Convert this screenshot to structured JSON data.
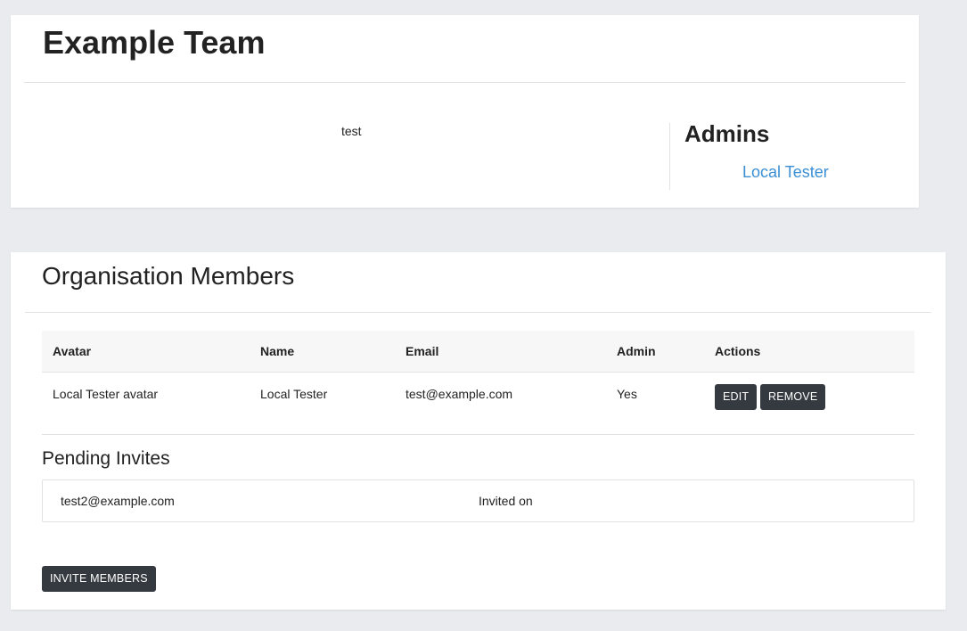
{
  "team": {
    "title": "Example Team",
    "description": "test",
    "admins_heading": "Admins",
    "admins": [
      "Local Tester"
    ]
  },
  "members": {
    "heading": "Organisation Members",
    "columns": [
      "Avatar",
      "Name",
      "Email",
      "Admin",
      "Actions"
    ],
    "rows": [
      {
        "avatar": "Local Tester avatar",
        "name": "Local Tester",
        "email": "test@example.com",
        "admin": "Yes",
        "edit_label": "EDIT",
        "remove_label": "REMOVE"
      }
    ],
    "pending_heading": "Pending Invites",
    "pending": [
      {
        "email": "test2@example.com",
        "invited_label": "Invited on"
      }
    ],
    "invite_button_label": "INVITE MEMBERS"
  },
  "colors": {
    "background": "#e9ebee",
    "link": "#3b8fd4",
    "button": "#343a40"
  }
}
